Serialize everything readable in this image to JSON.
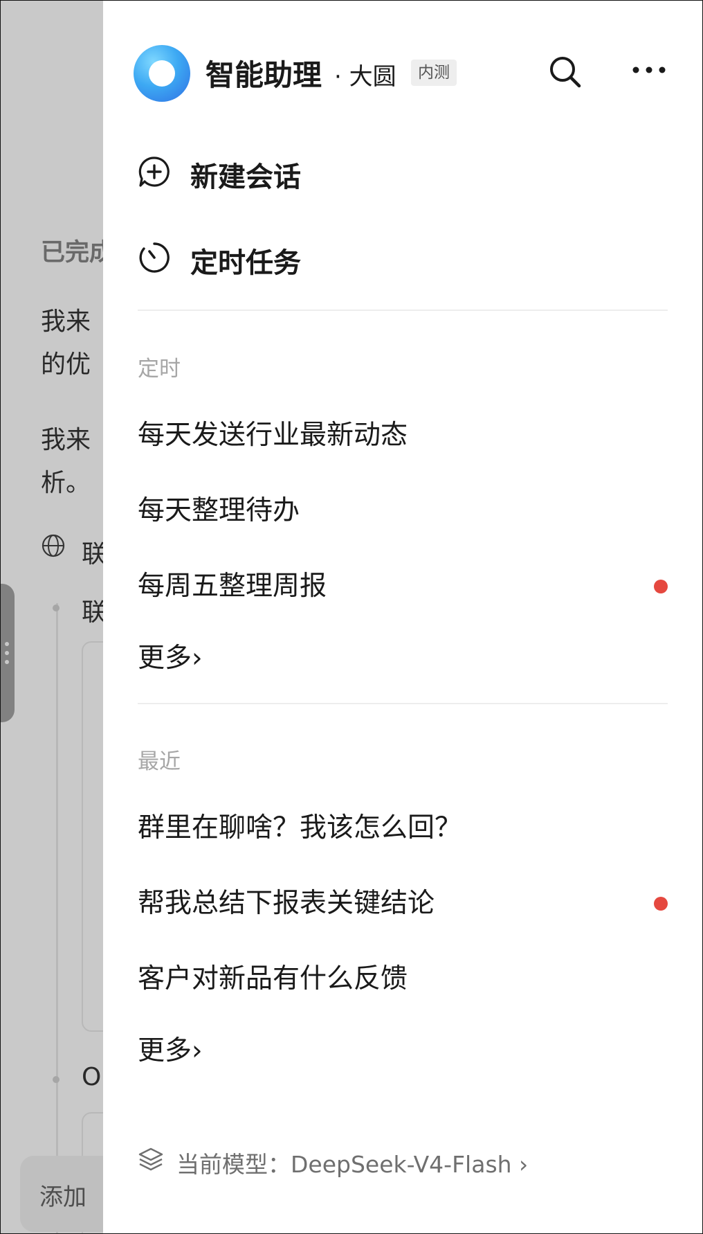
{
  "background": {
    "lines": [
      "已完成",
      "我来",
      "的优",
      "我来",
      "析。",
      "联",
      "联",
      "O"
    ],
    "add_label": "添加"
  },
  "header": {
    "title": "智能助理",
    "subtitle": "· 大圆",
    "badge": "内测"
  },
  "actions": {
    "new_chat": "新建会话",
    "scheduled": "定时任务"
  },
  "scheduled_section": {
    "title": "定时",
    "items": [
      {
        "label": "每天发送行业最新动态",
        "unread": false
      },
      {
        "label": "每天整理待办",
        "unread": false
      },
      {
        "label": "每周五整理周报",
        "unread": true
      }
    ],
    "more": "更多›"
  },
  "recent_section": {
    "title": "最近",
    "items": [
      {
        "label": "群里在聊啥？我该怎么回？",
        "unread": false
      },
      {
        "label": "帮我总结下报表关键结论",
        "unread": true
      },
      {
        "label": "客户对新品有什么反馈",
        "unread": false
      }
    ],
    "more": "更多›"
  },
  "model": {
    "label": "当前模型：DeepSeek-V4-Flash ›"
  },
  "colors": {
    "unread_dot": "#e5483f",
    "logo_primary": "#3da9f3"
  }
}
